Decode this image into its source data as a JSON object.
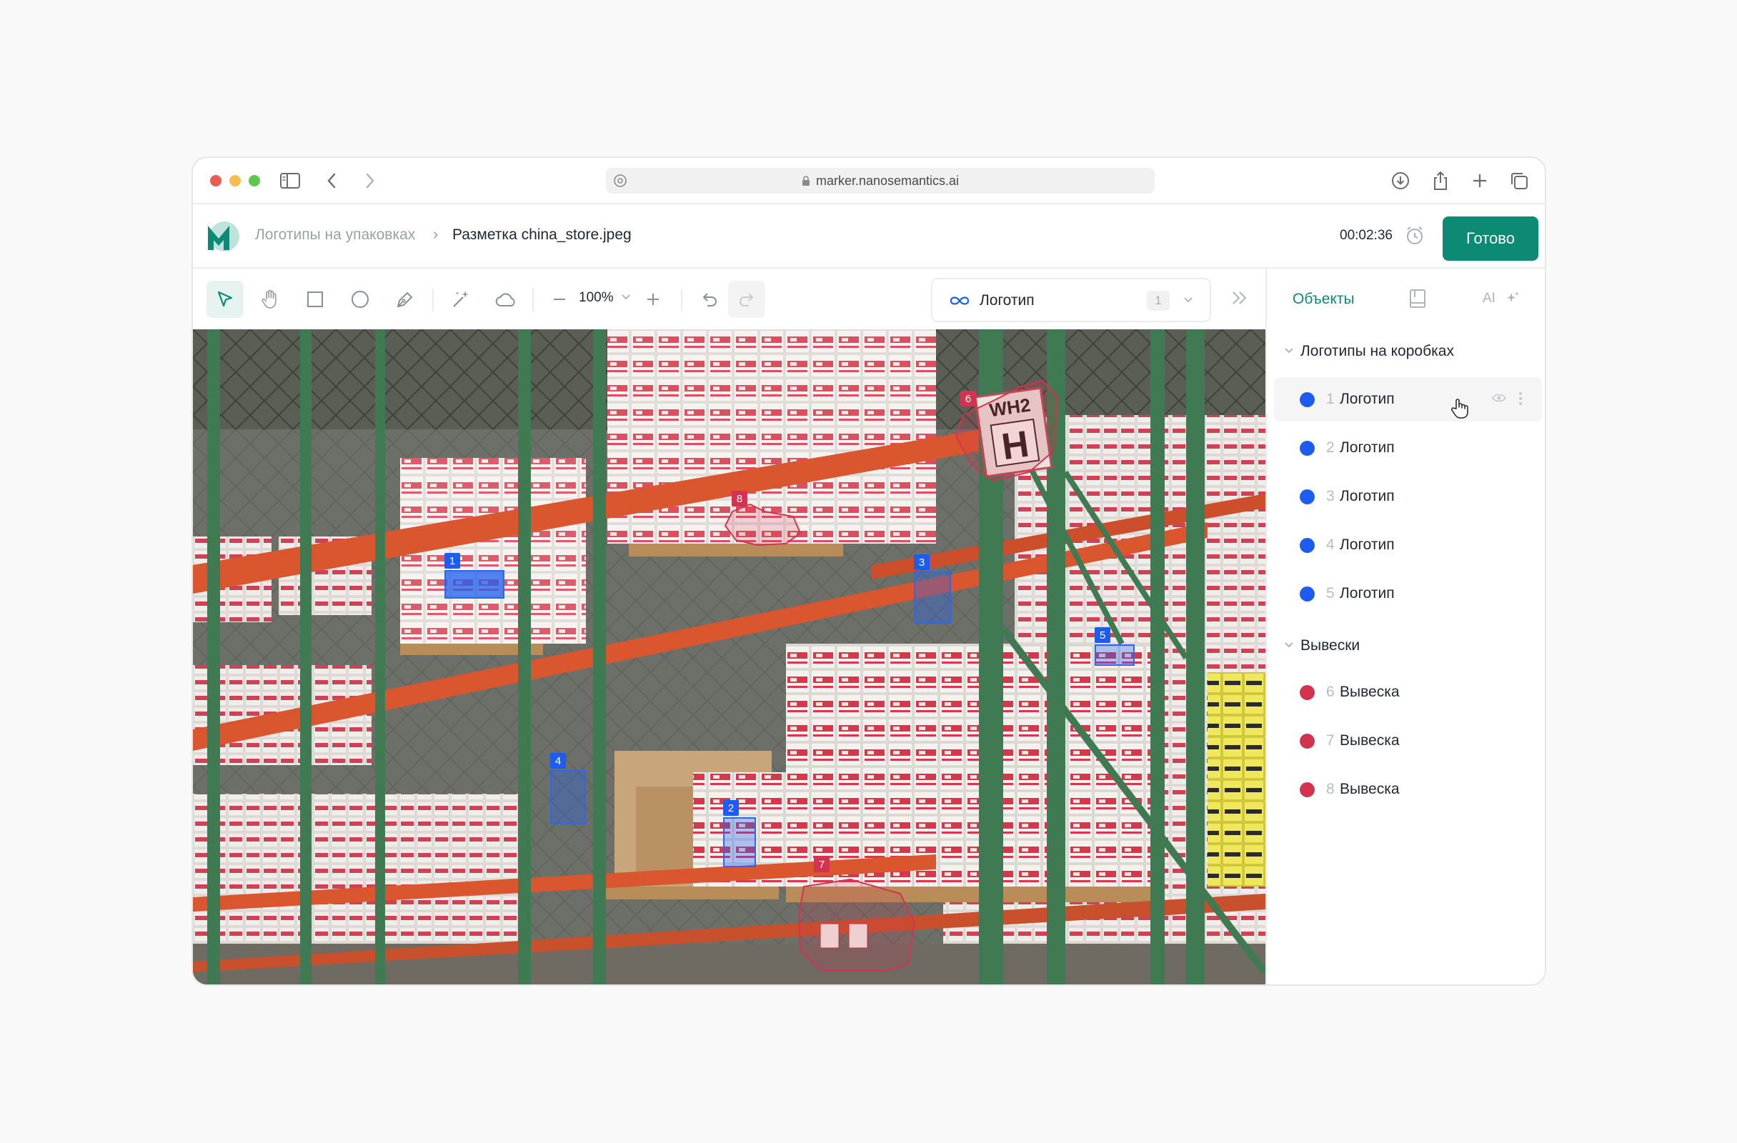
{
  "browser": {
    "url": "marker.nanosemantics.ai",
    "traffic_lights": [
      "#ee5a52",
      "#f5be4f",
      "#5ec84a"
    ]
  },
  "header": {
    "breadcrumb_project": "Логотипы на упаковках",
    "breadcrumb_separator": "›",
    "page_title": "Разметка china_store.jpeg",
    "timer": "00:02:36",
    "done_label": "Готово"
  },
  "toolbar": {
    "tools": [
      "select-tool",
      "hand-tool",
      "rectangle-tool",
      "ellipse-tool",
      "pen-tool",
      "magic-wand-tool",
      "cloud-tool"
    ],
    "active_tool": "select-tool",
    "zoom": "100%",
    "class_selector": {
      "label": "Логотип",
      "count": "1"
    }
  },
  "colors": {
    "accent": "#0d8a74",
    "logo_class": "#1c5cf0",
    "sign_class": "#d3334f"
  },
  "canvas": {
    "annotations": [
      {
        "id": "1",
        "class": "logo"
      },
      {
        "id": "2",
        "class": "logo"
      },
      {
        "id": "3",
        "class": "logo"
      },
      {
        "id": "4",
        "class": "logo"
      },
      {
        "id": "5",
        "class": "logo"
      },
      {
        "id": "6",
        "class": "sign"
      },
      {
        "id": "7",
        "class": "sign"
      },
      {
        "id": "8",
        "class": "sign"
      }
    ],
    "sign_text": {
      "top": "WH2",
      "big": "H"
    }
  },
  "panel": {
    "tab_objects": "Объекты",
    "tab_ai": "AI",
    "groups": [
      {
        "name": "Логотипы на коробках",
        "items": [
          {
            "num": "1",
            "name": "Логотип"
          },
          {
            "num": "2",
            "name": "Логотип"
          },
          {
            "num": "3",
            "name": "Логотип"
          },
          {
            "num": "4",
            "name": "Логотип"
          },
          {
            "num": "5",
            "name": "Логотип"
          }
        ]
      },
      {
        "name": "Вывески",
        "items": [
          {
            "num": "6",
            "name": "Вывеска"
          },
          {
            "num": "7",
            "name": "Вывеска"
          },
          {
            "num": "8",
            "name": "Вывеска"
          }
        ]
      }
    ]
  }
}
